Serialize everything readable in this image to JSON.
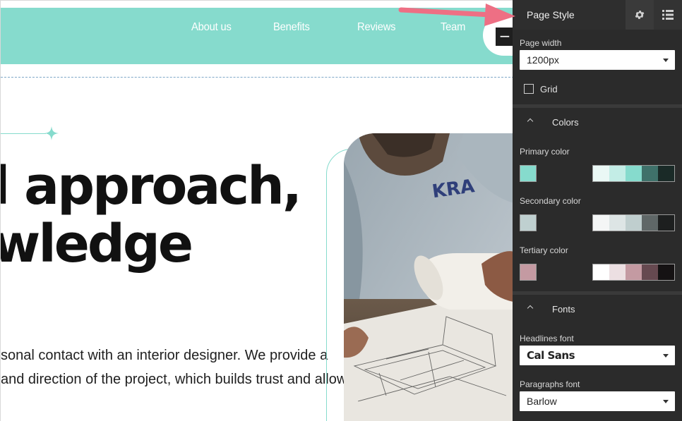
{
  "nav": {
    "links": [
      "About us",
      "Benefits",
      "Reviews",
      "Team"
    ],
    "minus_glyph": "−"
  },
  "hero": {
    "headline_line1": "l approach,",
    "headline_line2": "wledge",
    "body_line1": "sonal contact with an interior designer. We provide a",
    "body_line2": "and direction of the project, which builds trust and allows",
    "image_text": "KRA"
  },
  "panel": {
    "title": "Page Style",
    "icons": [
      "gear-icon",
      "list-icon"
    ],
    "page_width_label": "Page width",
    "page_width_value": "1200px",
    "grid_label": "Grid",
    "grid_checked": false,
    "colors_section": "Colors",
    "primary_label": "Primary color",
    "primary_color": "#86dbcd",
    "primary_palette": [
      "#eaf8f5",
      "#c3ede6",
      "#86dbcd",
      "#3f716a",
      "#1a2a27"
    ],
    "secondary_label": "Secondary color",
    "secondary_color": "#bfd0d0",
    "secondary_palette": [
      "#f4f6f6",
      "#dde5e5",
      "#bfcece",
      "#5f6767",
      "#1d1f1f"
    ],
    "tertiary_label": "Tertiary color",
    "tertiary_color": "#c49aa2",
    "tertiary_palette": [
      "#ffffff",
      "#ecdfe2",
      "#c49aa2",
      "#664950",
      "#151213"
    ],
    "fonts_section": "Fonts",
    "headlines_font_label": "Headlines font",
    "headlines_font_value": "Cal Sans",
    "paragraphs_font_label": "Paragraphs font",
    "paragraphs_font_value": "Barlow"
  },
  "colors": {
    "accent": "#86dbcd",
    "panel_bg": "#2b2b2b",
    "annotation_arrow": "#ee6f84"
  }
}
